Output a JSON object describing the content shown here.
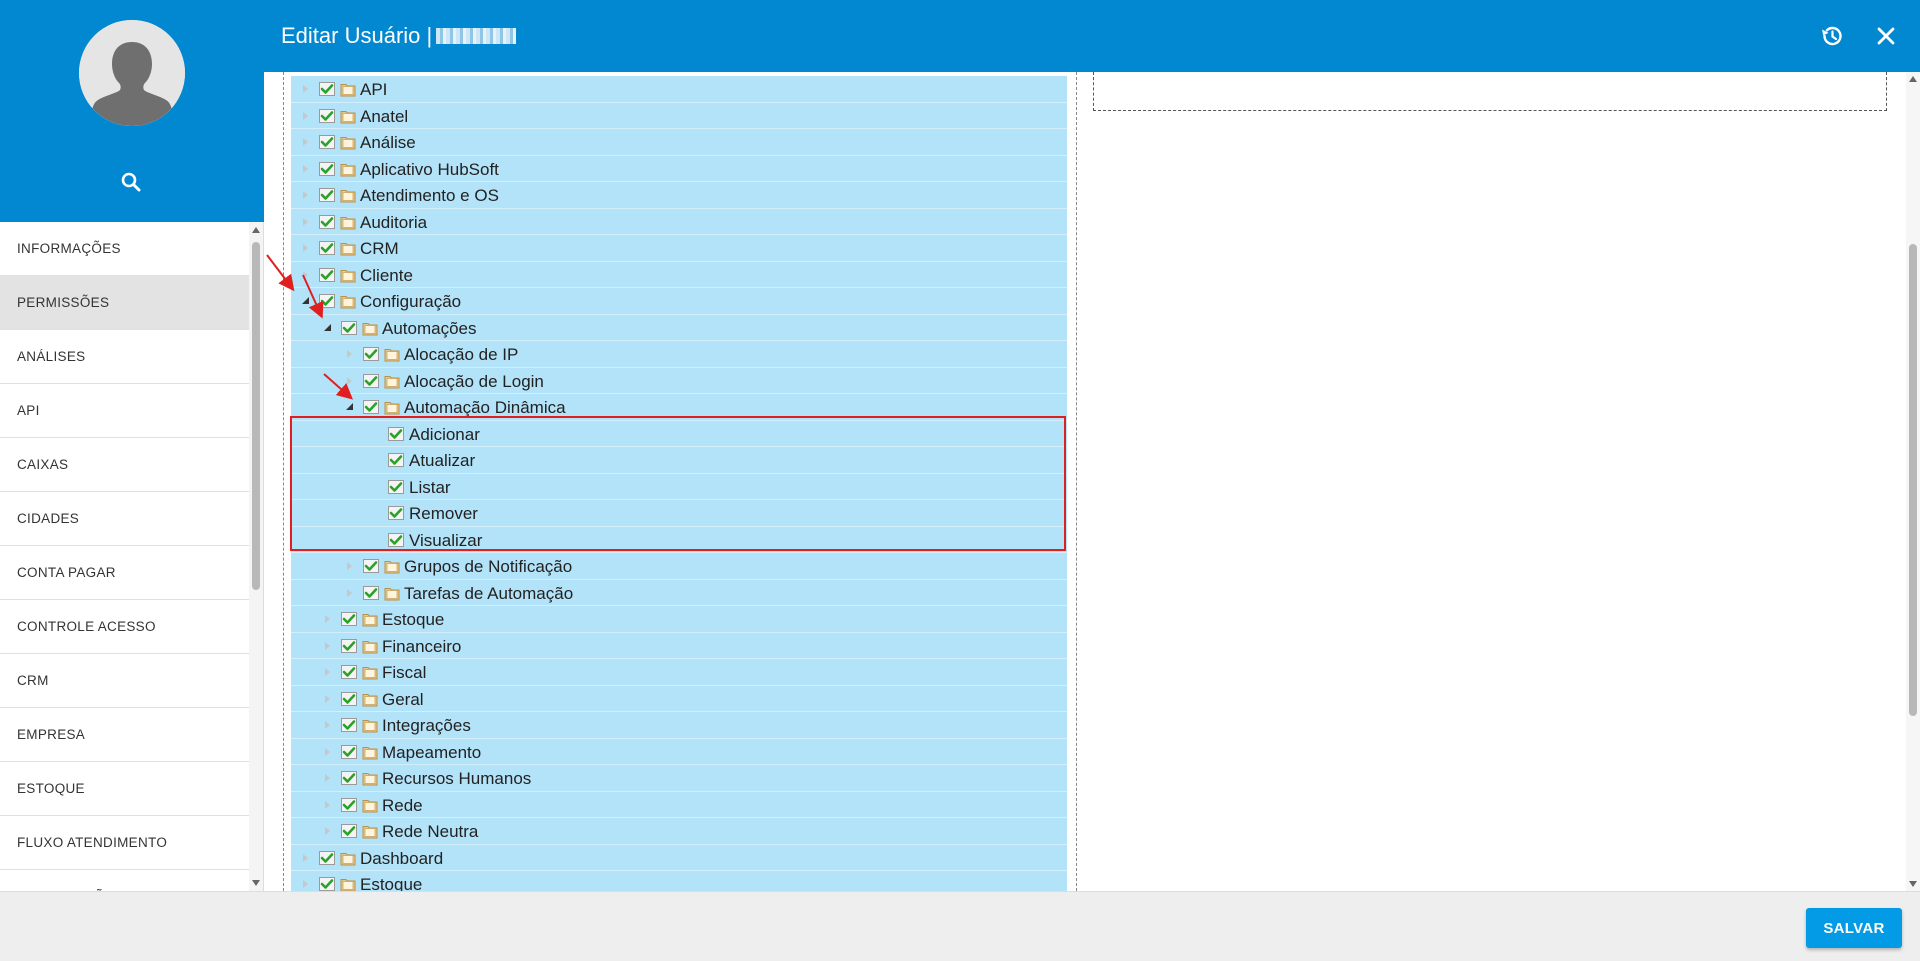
{
  "header": {
    "title": "Editar Usuário |",
    "history_icon": "history-icon",
    "close_icon": "close-icon",
    "color": "#0288d1"
  },
  "sidebar": {
    "search_icon": "search-icon",
    "items": [
      {
        "label": "INFORMAÇÕES",
        "active": false
      },
      {
        "label": "PERMISSÕES",
        "active": true
      },
      {
        "label": "ANÁLISES",
        "active": false
      },
      {
        "label": "API",
        "active": false
      },
      {
        "label": "CAIXAS",
        "active": false
      },
      {
        "label": "CIDADES",
        "active": false
      },
      {
        "label": "CONTA PAGAR",
        "active": false
      },
      {
        "label": "CONTROLE ACESSO",
        "active": false
      },
      {
        "label": "CRM",
        "active": false
      },
      {
        "label": "EMPRESA",
        "active": false
      },
      {
        "label": "ESTOQUE",
        "active": false
      },
      {
        "label": "FLUXO ATENDIMENTO",
        "active": false
      },
      {
        "label": "LOCALIZAÇÃO",
        "active": false
      }
    ]
  },
  "tree": [
    {
      "label": "API",
      "level": 0,
      "state": "collapsed",
      "folder": true,
      "checked": true
    },
    {
      "label": "Anatel",
      "level": 0,
      "state": "collapsed",
      "folder": true,
      "checked": true
    },
    {
      "label": "Análise",
      "level": 0,
      "state": "collapsed",
      "folder": true,
      "checked": true
    },
    {
      "label": "Aplicativo HubSoft",
      "level": 0,
      "state": "collapsed",
      "folder": true,
      "checked": true
    },
    {
      "label": "Atendimento e OS",
      "level": 0,
      "state": "collapsed",
      "folder": true,
      "checked": true
    },
    {
      "label": "Auditoria",
      "level": 0,
      "state": "collapsed",
      "folder": true,
      "checked": true
    },
    {
      "label": "CRM",
      "level": 0,
      "state": "collapsed",
      "folder": true,
      "checked": true
    },
    {
      "label": "Cliente",
      "level": 0,
      "state": "collapsed",
      "folder": true,
      "checked": true
    },
    {
      "label": "Configuração",
      "level": 0,
      "state": "expanded",
      "folder": true,
      "checked": true
    },
    {
      "label": "Automações",
      "level": 1,
      "state": "expanded",
      "folder": true,
      "checked": true
    },
    {
      "label": "Alocação de IP",
      "level": 2,
      "state": "collapsed",
      "folder": true,
      "checked": true
    },
    {
      "label": "Alocação de Login",
      "level": 2,
      "state": "collapsed",
      "folder": true,
      "checked": true
    },
    {
      "label": "Automação Dinâmica",
      "level": 2,
      "state": "expanded",
      "folder": true,
      "checked": true
    },
    {
      "label": "Adicionar",
      "level": 3,
      "state": "leaf",
      "folder": false,
      "checked": true
    },
    {
      "label": "Atualizar",
      "level": 3,
      "state": "leaf",
      "folder": false,
      "checked": true
    },
    {
      "label": "Listar",
      "level": 3,
      "state": "leaf",
      "folder": false,
      "checked": true
    },
    {
      "label": "Remover",
      "level": 3,
      "state": "leaf",
      "folder": false,
      "checked": true
    },
    {
      "label": "Visualizar",
      "level": 3,
      "state": "leaf",
      "folder": false,
      "checked": true
    },
    {
      "label": "Grupos de Notificação",
      "level": 2,
      "state": "collapsed",
      "folder": true,
      "checked": true
    },
    {
      "label": "Tarefas de Automação",
      "level": 2,
      "state": "collapsed",
      "folder": true,
      "checked": true
    },
    {
      "label": "Estoque",
      "level": 1,
      "state": "collapsed",
      "folder": true,
      "checked": true
    },
    {
      "label": "Financeiro",
      "level": 1,
      "state": "collapsed",
      "folder": true,
      "checked": true
    },
    {
      "label": "Fiscal",
      "level": 1,
      "state": "collapsed",
      "folder": true,
      "checked": true
    },
    {
      "label": "Geral",
      "level": 1,
      "state": "collapsed",
      "folder": true,
      "checked": true
    },
    {
      "label": "Integrações",
      "level": 1,
      "state": "collapsed",
      "folder": true,
      "checked": true
    },
    {
      "label": "Mapeamento",
      "level": 1,
      "state": "collapsed",
      "folder": true,
      "checked": true
    },
    {
      "label": "Recursos Humanos",
      "level": 1,
      "state": "collapsed",
      "folder": true,
      "checked": true
    },
    {
      "label": "Rede",
      "level": 1,
      "state": "collapsed",
      "folder": true,
      "checked": true
    },
    {
      "label": "Rede Neutra",
      "level": 1,
      "state": "collapsed",
      "folder": true,
      "checked": true
    },
    {
      "label": "Dashboard",
      "level": 0,
      "state": "collapsed",
      "folder": true,
      "checked": true
    },
    {
      "label": "Estoque",
      "level": 0,
      "state": "collapsed",
      "folder": true,
      "checked": true
    }
  ],
  "footer": {
    "save_label": "SALVAR",
    "save_color": "#039be5"
  },
  "colors": {
    "row_bg": "#b3e3f9",
    "highlight": "#e02020"
  }
}
